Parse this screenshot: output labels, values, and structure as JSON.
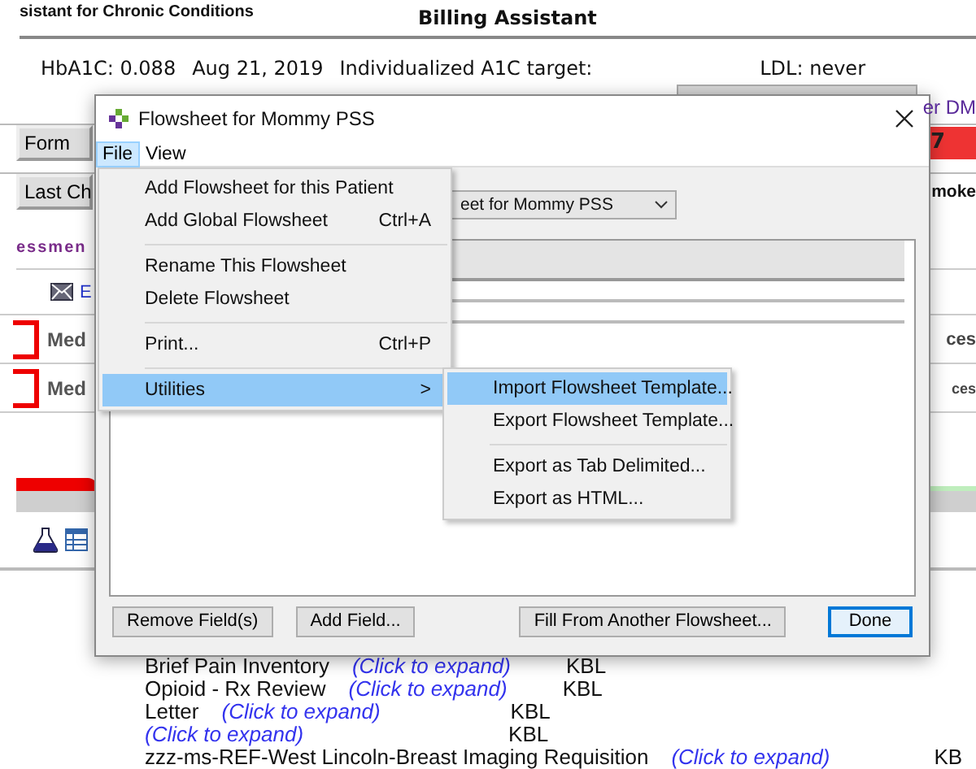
{
  "app": {
    "header_left": "sistant for Chronic Conditions",
    "header_title": "Billing Assistant",
    "summary": [
      "HbA1C: 0.088",
      "Aug 21, 2019",
      "Individualized A1C target:"
    ],
    "ldl": "LDL: never",
    "link_right": "er DM",
    "form_button": "Form",
    "alert_value": "7",
    "last_button": "Last Ch",
    "right_label": "moke",
    "section": "essmen",
    "email_link": "E",
    "med_rows": [
      {
        "label": "Med",
        "right": "ces"
      },
      {
        "label": "Med",
        "right": "ces"
      }
    ],
    "documents": [
      {
        "name": "Brief Pain Inventory",
        "link": "(Click to expand)",
        "author": "KBL"
      },
      {
        "name": "Opioid - Rx Review",
        "link": "(Click to expand)",
        "author": "KBL"
      },
      {
        "name": "Letter",
        "link": "(Click to expand)",
        "author": "KBL"
      },
      {
        "link": "(Click to expand)",
        "author": "KBL"
      },
      {
        "name": "zzz-ms-REF-West Lincoln-Breast Imaging Requisition",
        "link": "(Click to expand)",
        "author": "KB"
      }
    ]
  },
  "dialog": {
    "title": "Flowsheet for Mommy PSS",
    "menus": [
      {
        "label": "File",
        "selected": true
      },
      {
        "label": "View",
        "selected": false
      }
    ],
    "flowsheet_select": "eet for Mommy PSS",
    "buttons": [
      {
        "label": "Remove Field(s)",
        "default": false
      },
      {
        "label": "Add Field...",
        "default": false
      },
      {
        "label": "Fill From Another Flowsheet...",
        "default": false
      },
      {
        "label": "Done",
        "default": true
      }
    ],
    "file_menu": [
      {
        "kind": "item",
        "label": "Add Flowsheet for this Patient",
        "selected": false
      },
      {
        "kind": "item",
        "label": "Add Global Flowsheet",
        "shortcut": "Ctrl+A",
        "selected": false
      },
      {
        "kind": "separator"
      },
      {
        "kind": "item",
        "label": "Rename This Flowsheet",
        "selected": false
      },
      {
        "kind": "item",
        "label": "Delete Flowsheet",
        "selected": false
      },
      {
        "kind": "separator"
      },
      {
        "kind": "item",
        "label": "Print...",
        "shortcut": "Ctrl+P",
        "selected": false
      },
      {
        "kind": "separator"
      },
      {
        "kind": "submenu",
        "label": "Utilities",
        "arrow": ">",
        "selected": true
      }
    ],
    "submenu": [
      {
        "kind": "item",
        "label": "Import Flowsheet Template...",
        "selected": true
      },
      {
        "kind": "item",
        "label": "Export Flowsheet Template...",
        "selected": false
      },
      {
        "kind": "separator"
      },
      {
        "kind": "item",
        "label": "Export as Tab Delimited...",
        "selected": false
      },
      {
        "kind": "item",
        "label": "Export as HTML...",
        "selected": false
      }
    ]
  }
}
